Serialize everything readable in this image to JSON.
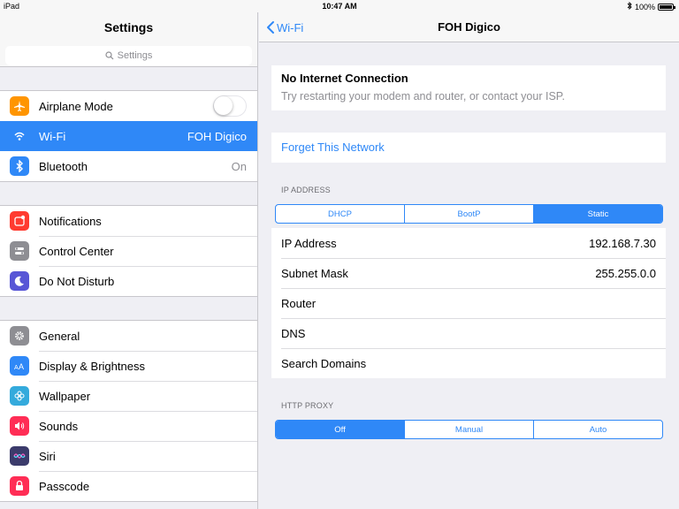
{
  "status_bar": {
    "device": "iPad",
    "time": "10:47 AM",
    "battery": "100%",
    "battery_level": 1.0
  },
  "master": {
    "title": "Settings",
    "search_placeholder": "Settings",
    "groups": [
      [
        {
          "name": "airplane-mode",
          "icon": "airplane-icon",
          "color": "#ff9500",
          "label": "Airplane Mode",
          "toggle": false
        },
        {
          "name": "wifi",
          "icon": "wifi-icon",
          "color": "#2f88f7",
          "label": "Wi-Fi",
          "value": "FOH Digico",
          "selected": true
        },
        {
          "name": "bluetooth",
          "icon": "bluetooth-icon",
          "color": "#2f88f7",
          "label": "Bluetooth",
          "value": "On"
        }
      ],
      [
        {
          "name": "notifications",
          "icon": "notifications-icon",
          "color": "#ff3b30",
          "label": "Notifications"
        },
        {
          "name": "control-center",
          "icon": "control-center-icon",
          "color": "#8e8e93",
          "label": "Control Center"
        },
        {
          "name": "do-not-disturb",
          "icon": "moon-icon",
          "color": "#5856d6",
          "label": "Do Not Disturb"
        }
      ],
      [
        {
          "name": "general",
          "icon": "gear-icon",
          "color": "#8e8e93",
          "label": "General"
        },
        {
          "name": "display-brightness",
          "icon": "text-size-icon",
          "color": "#2f88f7",
          "label": "Display & Brightness"
        },
        {
          "name": "wallpaper",
          "icon": "flower-icon",
          "color": "#34aadc",
          "label": "Wallpaper"
        },
        {
          "name": "sounds",
          "icon": "speaker-icon",
          "color": "#ff2d55",
          "label": "Sounds"
        },
        {
          "name": "siri",
          "icon": "siri-icon",
          "color": "#3b3b6b",
          "label": "Siri"
        },
        {
          "name": "passcode",
          "icon": "lock-icon",
          "color": "#ff2d55",
          "label": "Passcode"
        }
      ]
    ]
  },
  "detail": {
    "back_label": "Wi-Fi",
    "title": "FOH Digico",
    "notice_title": "No Internet Connection",
    "notice_text": "Try restarting your modem and router, or contact your ISP.",
    "forget_label": "Forget This Network",
    "ip_section_label": "IP ADDRESS",
    "ip_modes": [
      "DHCP",
      "BootP",
      "Static"
    ],
    "ip_mode_selected": "Static",
    "fields": [
      {
        "label": "IP Address",
        "value": "192.168.7.30"
      },
      {
        "label": "Subnet Mask",
        "value": "255.255.0.0"
      },
      {
        "label": "Router",
        "value": ""
      },
      {
        "label": "DNS",
        "value": ""
      },
      {
        "label": "Search Domains",
        "value": ""
      }
    ],
    "proxy_section_label": "HTTP PROXY",
    "proxy_modes": [
      "Off",
      "Manual",
      "Auto"
    ],
    "proxy_mode_selected": "Off"
  },
  "colors": {
    "accent": "#2f88f7",
    "background": "#efeff4"
  }
}
